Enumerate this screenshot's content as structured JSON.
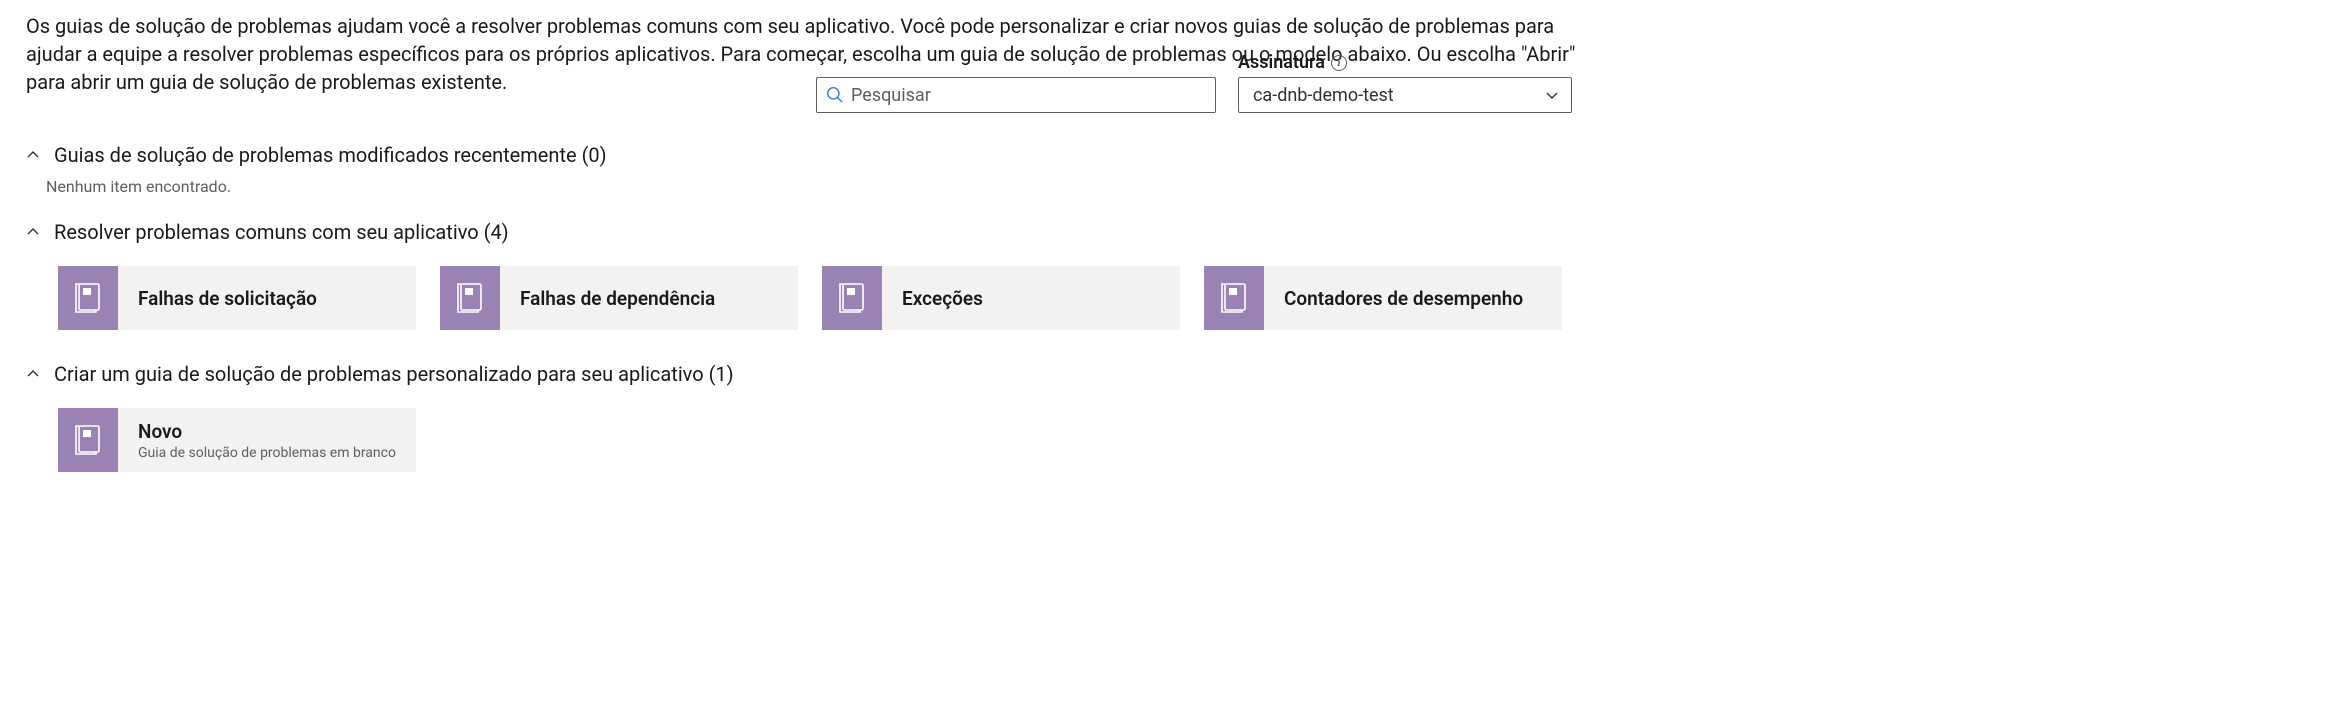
{
  "intro": "Os guias de solução de problemas ajudam você a resolver problemas comuns com seu aplicativo. Você pode personalizar e criar novos guias de solução de problemas para ajudar a equipe a resolver problemas específicos para os próprios aplicativos. Para começar, escolha um guia de solução de problemas ou o modelo abaixo. Ou escolha \"Abrir\" para abrir um guia de solução de problemas existente.",
  "search": {
    "placeholder": "Pesquisar"
  },
  "subscription": {
    "label": "Assinatura",
    "value": "ca-dnb-demo-test"
  },
  "sections": {
    "recent": {
      "title": "Guias de solução de problemas modificados recentemente (0)",
      "empty": "Nenhum item encontrado."
    },
    "common": {
      "title": "Resolver problemas comuns com seu aplicativo (4)",
      "cards": [
        {
          "title": "Falhas de solicitação"
        },
        {
          "title": "Falhas de dependência"
        },
        {
          "title": "Exceções"
        },
        {
          "title": "Contadores de desempenho"
        }
      ]
    },
    "custom": {
      "title": "Criar um guia de solução de problemas personalizado para seu aplicativo (1)",
      "cards": [
        {
          "title": "Novo",
          "subtitle": "Guia de solução de problemas em branco"
        }
      ]
    }
  }
}
